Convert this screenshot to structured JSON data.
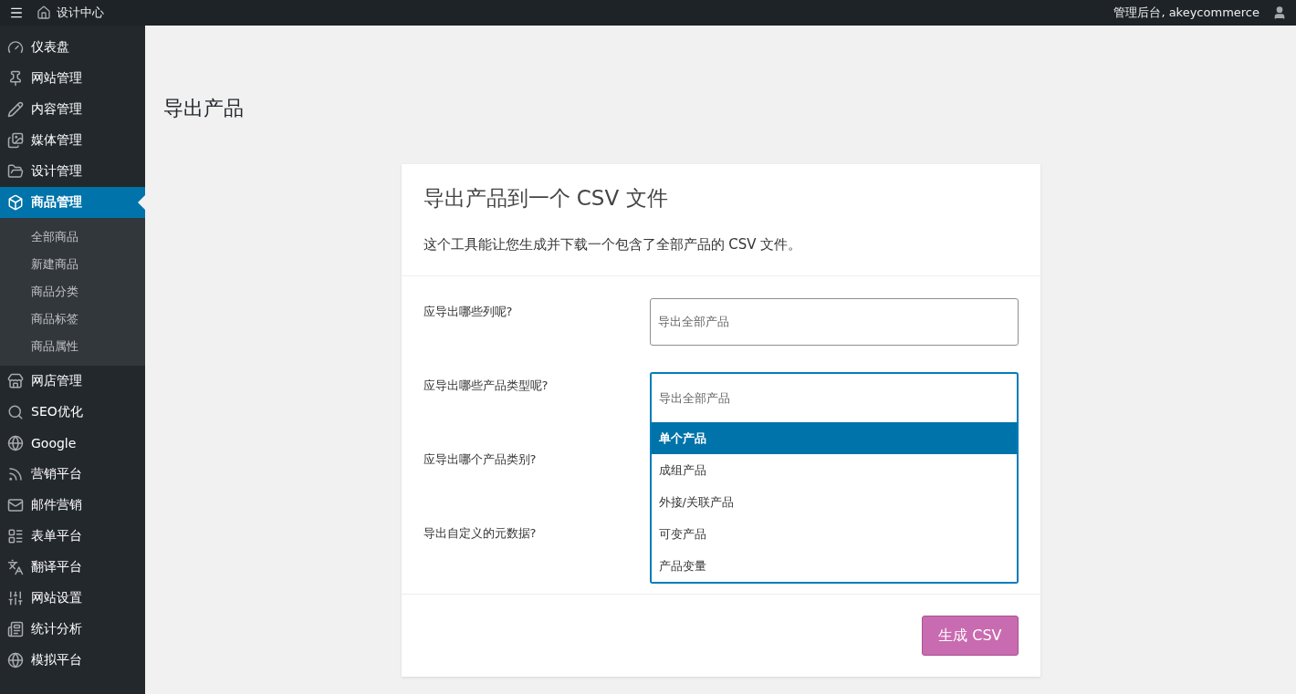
{
  "topbar": {
    "site": "设计中心",
    "account": "管理后台, akeycommerce"
  },
  "sidebar": {
    "items": [
      {
        "label": "仪表盘",
        "selected": false
      },
      {
        "label": "网站管理",
        "selected": false
      },
      {
        "label": "内容管理",
        "selected": false
      },
      {
        "label": "媒体管理",
        "selected": false
      },
      {
        "label": "设计管理",
        "selected": false
      },
      {
        "label": "商品管理",
        "selected": true,
        "children": [
          {
            "label": "全部商品"
          },
          {
            "label": "新建商品"
          },
          {
            "label": "商品分类"
          },
          {
            "label": "商品标签"
          },
          {
            "label": "商品属性"
          }
        ]
      },
      {
        "label": "网店管理",
        "selected": false
      },
      {
        "label": "SEO优化",
        "selected": false
      },
      {
        "label": "Google",
        "selected": false
      },
      {
        "label": "营销平台",
        "selected": false
      },
      {
        "label": "邮件营销",
        "selected": false
      },
      {
        "label": "表单平台",
        "selected": false
      },
      {
        "label": "翻译平台",
        "selected": false
      },
      {
        "label": "网站设置",
        "selected": false
      },
      {
        "label": "统计分析",
        "selected": false
      },
      {
        "label": "模拟平台",
        "selected": false
      }
    ]
  },
  "page": {
    "title": "导出产品"
  },
  "card": {
    "title": "导出产品到一个 CSV 文件",
    "description": "这个工具能让您生成并下载一个包含了全部产品的 CSV 文件。",
    "fields": [
      {
        "label": "应导出哪些列呢?",
        "kind": "select",
        "placeholder": "导出全部产品",
        "expanded": false
      },
      {
        "label": "应导出哪些产品类型呢?",
        "kind": "select",
        "placeholder": "导出全部产品",
        "expanded": true,
        "options": [
          {
            "label": "单个产品",
            "selected": true
          },
          {
            "label": "成组产品",
            "selected": false
          },
          {
            "label": "外接/关联产品",
            "selected": false
          },
          {
            "label": "可变产品",
            "selected": false
          },
          {
            "label": "产品变量",
            "selected": false
          }
        ]
      },
      {
        "label": "应导出哪个产品类别?",
        "kind": "hidden"
      },
      {
        "label": "导出自定义的元数据?",
        "kind": "hidden"
      }
    ],
    "button": "生成 CSV"
  }
}
